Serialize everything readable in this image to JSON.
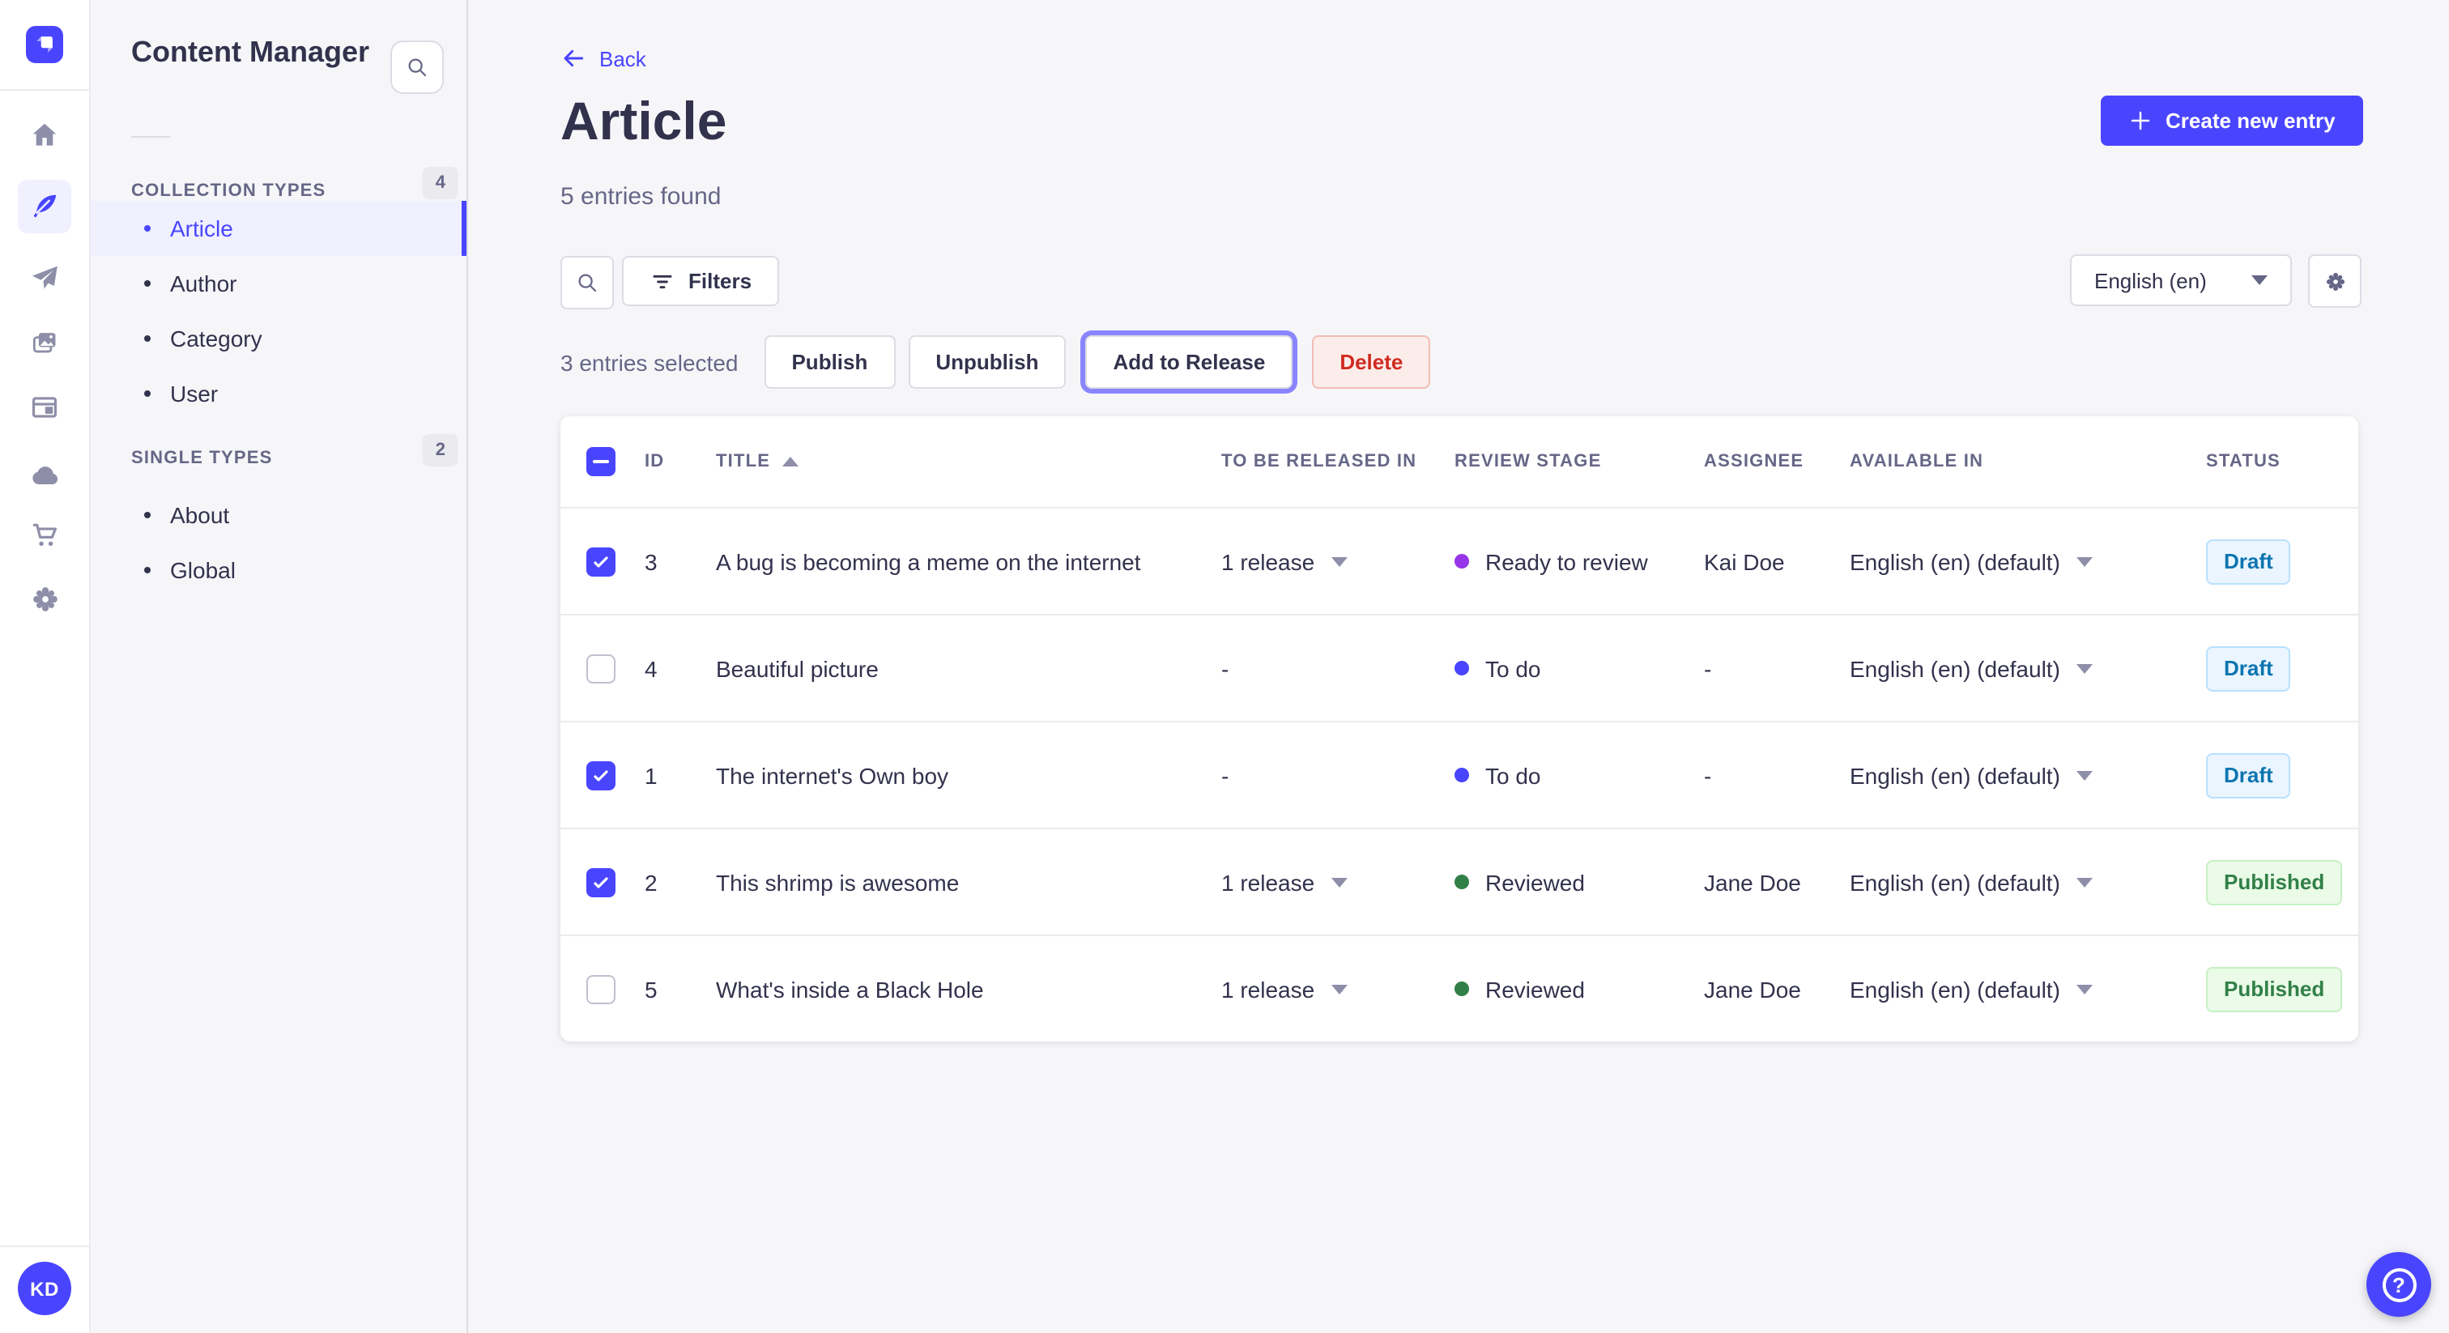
{
  "colors": {
    "primary": "#4945ff",
    "focus_ring": "#8a85ff",
    "status_draft_text": "#0c75af",
    "status_published_text": "#328048",
    "delete_text": "#d02b20",
    "stage_todo": "#4945ff",
    "stage_ready": "#9736e8",
    "stage_reviewed": "#328048"
  },
  "nav": {
    "logo_icon": "strapi-logo",
    "avatar_initials": "KD",
    "items": [
      {
        "icon": "home-icon",
        "active": false
      },
      {
        "icon": "feather-icon",
        "active": true
      },
      {
        "icon": "paper-plane-icon",
        "active": false
      },
      {
        "icon": "media-icon",
        "active": false
      },
      {
        "icon": "layout-icon",
        "active": false
      },
      {
        "icon": "cloud-icon",
        "active": false
      },
      {
        "icon": "cart-icon",
        "active": false
      },
      {
        "icon": "gear-icon",
        "active": false
      }
    ]
  },
  "panel": {
    "title": "Content Manager",
    "search_icon": "search-icon",
    "sections": [
      {
        "label": "COLLECTION TYPES",
        "badge": "4",
        "items": [
          {
            "label": "Article",
            "active": true
          },
          {
            "label": "Author",
            "active": false
          },
          {
            "label": "Category",
            "active": false
          },
          {
            "label": "User",
            "active": false
          }
        ]
      },
      {
        "label": "SINGLE TYPES",
        "badge": "2",
        "items": [
          {
            "label": "About",
            "active": false
          },
          {
            "label": "Global",
            "active": false
          }
        ]
      }
    ]
  },
  "header": {
    "back_label": "Back",
    "title": "Article",
    "subtitle": "5 entries found",
    "create_button_label": "Create new entry"
  },
  "toolbar": {
    "filters_label": "Filters",
    "locale_value": "English (en)"
  },
  "selection": {
    "text": "3 entries selected",
    "publish_label": "Publish",
    "unpublish_label": "Unpublish",
    "add_to_release_label": "Add to Release",
    "delete_label": "Delete"
  },
  "table": {
    "select_all_state": "indeterminate",
    "sorted_column": "TITLE",
    "sort_direction": "asc",
    "columns": [
      "ID",
      "TITLE",
      "TO BE RELEASED IN",
      "REVIEW STAGE",
      "ASSIGNEE",
      "AVAILABLE IN",
      "STATUS"
    ],
    "rows": [
      {
        "checked": true,
        "id": "3",
        "title": "A bug is becoming a meme on the internet",
        "to_be_released_in": "1 release",
        "review_stage": {
          "label": "Ready to review",
          "color": "#9736e8"
        },
        "assignee": "Kai Doe",
        "available_in": "English (en) (default)",
        "status": "Draft"
      },
      {
        "checked": false,
        "id": "4",
        "title": "Beautiful picture",
        "to_be_released_in": "-",
        "review_stage": {
          "label": "To do",
          "color": "#4945ff"
        },
        "assignee": "-",
        "available_in": "English (en) (default)",
        "status": "Draft"
      },
      {
        "checked": true,
        "id": "1",
        "title": "The internet's Own boy",
        "to_be_released_in": "-",
        "review_stage": {
          "label": "To do",
          "color": "#4945ff"
        },
        "assignee": "-",
        "available_in": "English (en) (default)",
        "status": "Draft"
      },
      {
        "checked": true,
        "id": "2",
        "title": "This shrimp is awesome",
        "to_be_released_in": "1 release",
        "review_stage": {
          "label": "Reviewed",
          "color": "#328048"
        },
        "assignee": "Jane Doe",
        "available_in": "English (en) (default)",
        "status": "Published"
      },
      {
        "checked": false,
        "id": "5",
        "title": "What's inside a Black Hole",
        "to_be_released_in": "1 release",
        "review_stage": {
          "label": "Reviewed",
          "color": "#328048"
        },
        "assignee": "Jane Doe",
        "available_in": "English (en) (default)",
        "status": "Published"
      }
    ]
  },
  "footer": {
    "help_icon": "question-mark-icon",
    "avatar_initials": "KD"
  }
}
